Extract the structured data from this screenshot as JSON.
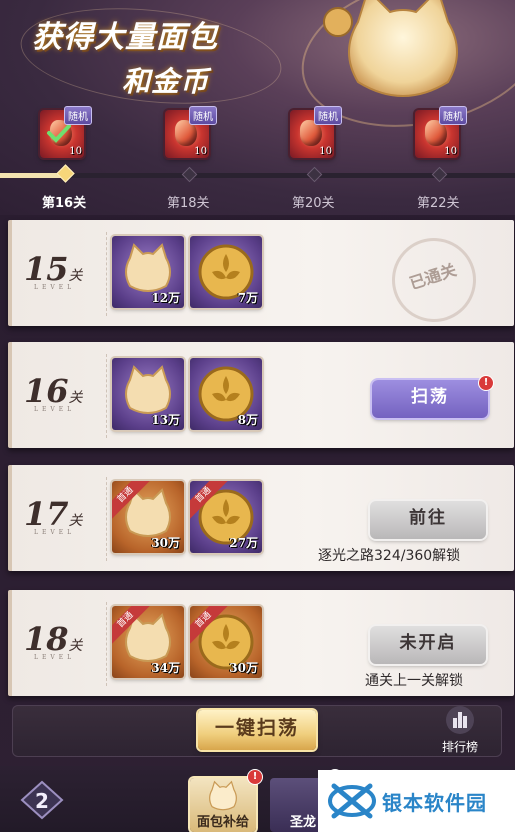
{
  "header": {
    "title_line1": "获得大量面包",
    "title_line2": "和金币"
  },
  "rewards": [
    {
      "tag": "随机",
      "count": "10",
      "claimed": true
    },
    {
      "tag": "随机",
      "count": "10",
      "claimed": false
    },
    {
      "tag": "随机",
      "count": "10",
      "claimed": false
    },
    {
      "tag": "随机",
      "count": "10",
      "claimed": false
    }
  ],
  "milestones": [
    "第16关",
    "第18关",
    "第20关",
    "第22关"
  ],
  "levels": [
    {
      "number": "15",
      "unit": "关",
      "sub": "LEVEL",
      "items": [
        {
          "icon": "bread-icon",
          "amount": "12万",
          "bg": "purple",
          "ribbon": ""
        },
        {
          "icon": "gold-coin-icon",
          "amount": "7万",
          "bg": "purple",
          "ribbon": ""
        }
      ],
      "status": "已通关"
    },
    {
      "number": "16",
      "unit": "关",
      "sub": "LEVEL",
      "items": [
        {
          "icon": "bread-icon",
          "amount": "13万",
          "bg": "purple",
          "ribbon": ""
        },
        {
          "icon": "gold-coin-icon",
          "amount": "8万",
          "bg": "purple",
          "ribbon": ""
        }
      ],
      "button": "扫荡",
      "badge": "!"
    },
    {
      "number": "17",
      "unit": "关",
      "sub": "LEVEL",
      "items": [
        {
          "icon": "bread-icon",
          "amount": "30万",
          "bg": "orange",
          "ribbon": "首通"
        },
        {
          "icon": "gold-coin-icon",
          "amount": "27万",
          "bg": "purple",
          "ribbon": "首通"
        }
      ],
      "button": "前往",
      "hint": "逐光之路324/360解锁"
    },
    {
      "number": "18",
      "unit": "关",
      "sub": "LEVEL",
      "items": [
        {
          "icon": "bread-icon",
          "amount": "34万",
          "bg": "orange",
          "ribbon": "首通"
        },
        {
          "icon": "gold-coin-icon",
          "amount": "30万",
          "bg": "orange",
          "ribbon": "首通"
        }
      ],
      "button": "未开启",
      "hint": "通关上一关解锁"
    }
  ],
  "bottom": {
    "one_key_sweep": "一键扫荡",
    "rank_label": "排行榜"
  },
  "nav": {
    "tab1": "面包补给",
    "tab2": "圣龙"
  },
  "watermark": "银本软件园",
  "colors": {
    "accent_purple": "#7462c0",
    "gold": "#f0cf7e",
    "badge_red": "#d93a3a"
  }
}
